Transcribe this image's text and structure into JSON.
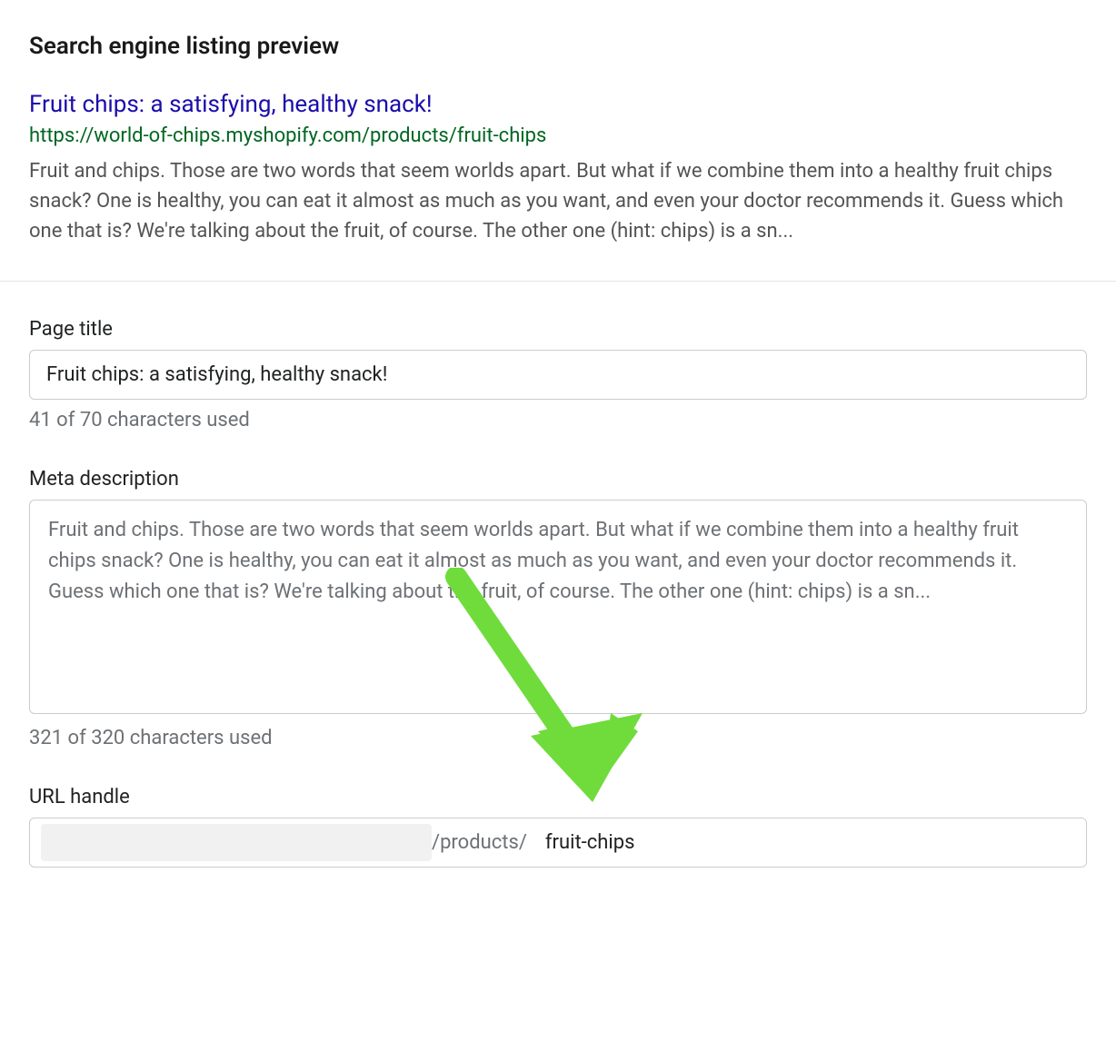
{
  "section_title": "Search engine listing preview",
  "preview": {
    "title": "Fruit chips: a satisfying, healthy snack!",
    "url": "https://world-of-chips.myshopify.com/products/fruit-chips",
    "description": "Fruit and chips. Those are two words that seem worlds apart. But what if we combine them into a healthy fruit chips snack? One is healthy, you can eat it almost as much as you want, and even your doctor recommends it. Guess which one that is? We're talking about the fruit, of course. The other one (hint: chips) is a sn..."
  },
  "page_title": {
    "label": "Page title",
    "value": "Fruit chips: a satisfying, healthy snack!",
    "helper": "41 of 70 characters used"
  },
  "meta_description": {
    "label": "Meta description",
    "value": "Fruit and chips. Those are two words that seem worlds apart. But what if we combine them into a healthy fruit chips snack? One is healthy, you can eat it almost as much as you want, and even your doctor recommends it. Guess which one that is? We're talking about the fruit, of course. The other one (hint: chips) is a sn...",
    "helper": "321 of 320 characters used"
  },
  "url_handle": {
    "label": "URL handle",
    "path_suffix": "/products/",
    "value": "fruit-chips"
  },
  "annotation": {
    "arrow_color": "#6fdc3c"
  }
}
